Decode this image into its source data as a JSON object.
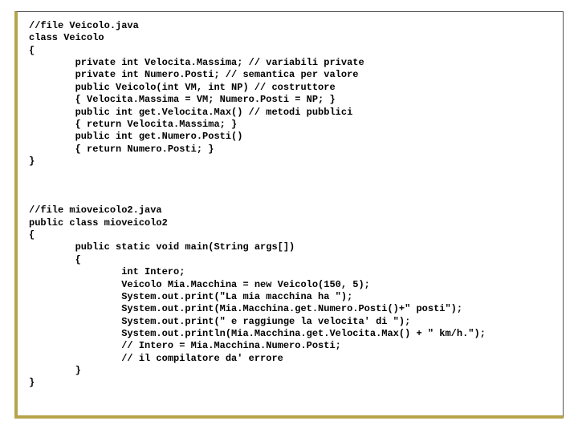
{
  "code": {
    "lines": [
      "//file Veicolo.java",
      "class Veicolo",
      "{",
      "        private int Velocita.Massima; // variabili private",
      "        private int Numero.Posti; // semantica per valore",
      "        public Veicolo(int VM, int NP) // costruttore",
      "        { Velocita.Massima = VM; Numero.Posti = NP; }",
      "        public int get.Velocita.Max() // metodi pubblici",
      "        { return Velocita.Massima; }",
      "        public int get.Numero.Posti()",
      "        { return Numero.Posti; }",
      "}",
      "",
      "",
      "",
      "//file mioveicolo2.java",
      "public class mioveicolo2",
      "{",
      "        public static void main(String args[])",
      "        {",
      "                int Intero;",
      "                Veicolo Mia.Macchina = new Veicolo(150, 5);",
      "                System.out.print(\"La mia macchina ha \");",
      "                System.out.print(Mia.Macchina.get.Numero.Posti()+\" posti\");",
      "                System.out.print(\" e raggiunge la velocita' di \");",
      "                System.out.println(Mia.Macchina.get.Velocita.Max() + \" km/h.\");",
      "                // Intero = Mia.Macchina.Numero.Posti;",
      "                // il compilatore da' errore",
      "        }",
      "}"
    ]
  }
}
